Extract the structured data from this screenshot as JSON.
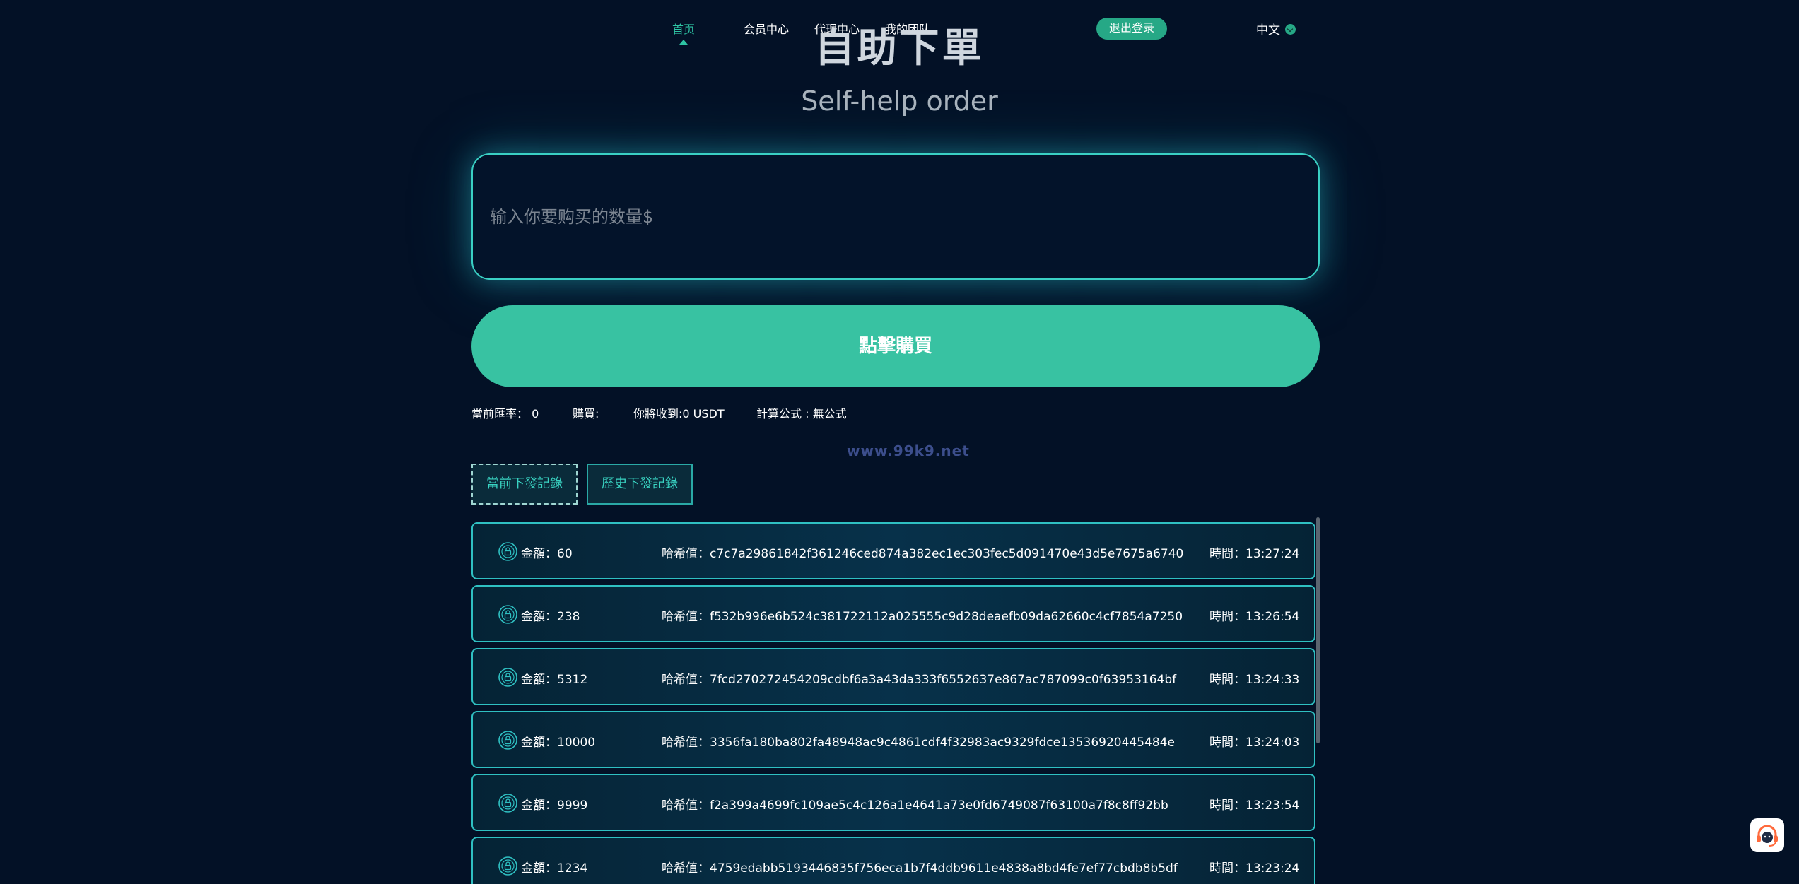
{
  "nav": {
    "items": [
      {
        "label": "首页",
        "active": true
      },
      {
        "label": "会员中心",
        "active": false
      },
      {
        "label": "代理中心",
        "active": false
      },
      {
        "label": "我的团队",
        "active": false
      }
    ],
    "logout_label": "退出登录",
    "language": "中文"
  },
  "hero": {
    "title_cn": "自助下單",
    "title_en": "Self-help order"
  },
  "order": {
    "amount_placeholder": "输入你要购买的数量$",
    "buy_label": "點擊購買"
  },
  "info": {
    "rate": "當前匯率： 0",
    "buy": "購買:",
    "receive": "你將收到:0 USDT",
    "formula": "計算公式 : 無公式"
  },
  "watermark": "www.99k9.net",
  "tabs": {
    "current": "當前下發記錄",
    "history": "歷史下發記錄"
  },
  "records": [
    {
      "amount": "金額：60",
      "hash": "哈希值：c7c7a29861842f361246ced874a382ec1ec303fec5d091470e43d5e7675a6740",
      "time": "時間：13:27:24"
    },
    {
      "amount": "金額：238",
      "hash": "哈希值：f532b996e6b524c381722112a025555c9d28deaefb09da62660c4cf7854a7250",
      "time": "時間：13:26:54"
    },
    {
      "amount": "金額：5312",
      "hash": "哈希值：7fcd270272454209cdbf6a3a43da333f6552637e867ac787099c0f63953164bf",
      "time": "時間：13:24:33"
    },
    {
      "amount": "金額：10000",
      "hash": "哈希值：3356fa180ba802fa48948ac9c4861cdf4f32983ac9329fdce13536920445484e",
      "time": "時間：13:24:03"
    },
    {
      "amount": "金額：9999",
      "hash": "哈希值：f2a399a4699fc109ae5c4c126a1e4641a73e0fd6749087f63100a7f8c8ff92bb",
      "time": "時間：13:23:54"
    },
    {
      "amount": "金額：1234",
      "hash": "哈希值：4759edabb5193446835f756eca1b7f4ddb9611e4838a8bd4fe7ef77cbdb8b5df",
      "time": "時間：13:23:24"
    }
  ],
  "colors": {
    "background": "#031126",
    "accent": "#38c2a2",
    "border_glow": "#3ad0c4"
  },
  "icons": {
    "record": "coin-lock-icon",
    "support": "headset-icon",
    "language_toggle": "chevron-down-icon"
  }
}
